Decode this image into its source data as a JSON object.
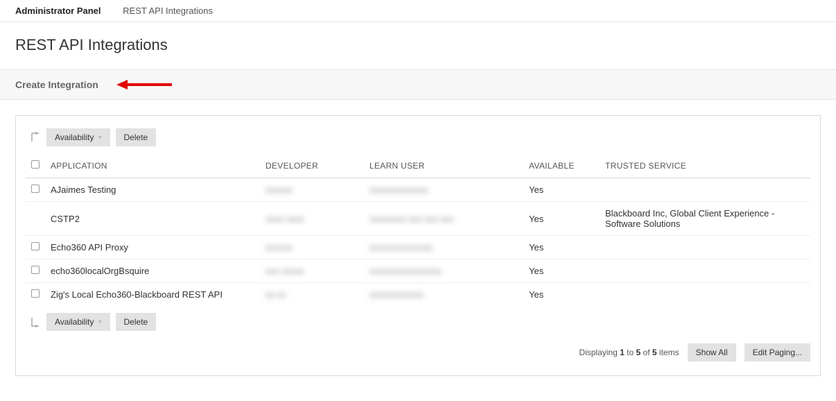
{
  "breadcrumb": {
    "admin": "Administrator Panel",
    "page": "REST API Integrations"
  },
  "page_title": "REST API Integrations",
  "create_link": "Create Integration",
  "buttons": {
    "availability": "Availability",
    "delete": "Delete",
    "show_all": "Show All",
    "edit_paging": "Edit Paging..."
  },
  "columns": {
    "application": "APPLICATION",
    "developer": "DEVELOPER",
    "learn_user": "LEARN USER",
    "available": "AVAILABLE",
    "trusted": "TRUSTED SERVICE"
  },
  "rows": [
    {
      "checkbox": true,
      "app": "AJaimes Testing",
      "dev": "xxxxxx",
      "user": "xxxxxxxxxxxxx",
      "avail": "Yes",
      "trusted": ""
    },
    {
      "checkbox": false,
      "app": "CSTP2",
      "dev": "xxxx xxxx",
      "user": "xxxxxxxx xxx xxx xxx",
      "avail": "Yes",
      "trusted": "Blackboard Inc, Global Client Experience - Software Solutions"
    },
    {
      "checkbox": true,
      "app": "Echo360 API Proxy",
      "dev": "xxxxxx",
      "user": "xxxxxxxxxxxxxx",
      "avail": "Yes",
      "trusted": ""
    },
    {
      "checkbox": true,
      "app": "echo360localOrgBsquire",
      "dev": "xxx xxxxx",
      "user": "xxxxxxxxxxxxxxxx",
      "avail": "Yes",
      "trusted": ""
    },
    {
      "checkbox": true,
      "app": "Zig's Local Echo360-Blackboard REST API",
      "dev": "xx xx",
      "user": "xxxxxxxxxxxx",
      "avail": "Yes",
      "trusted": ""
    }
  ],
  "pagination": {
    "prefix": "Displaying ",
    "from": "1",
    "mid1": " to ",
    "to": "5",
    "mid2": " of ",
    "total": "5",
    "suffix": " items"
  }
}
